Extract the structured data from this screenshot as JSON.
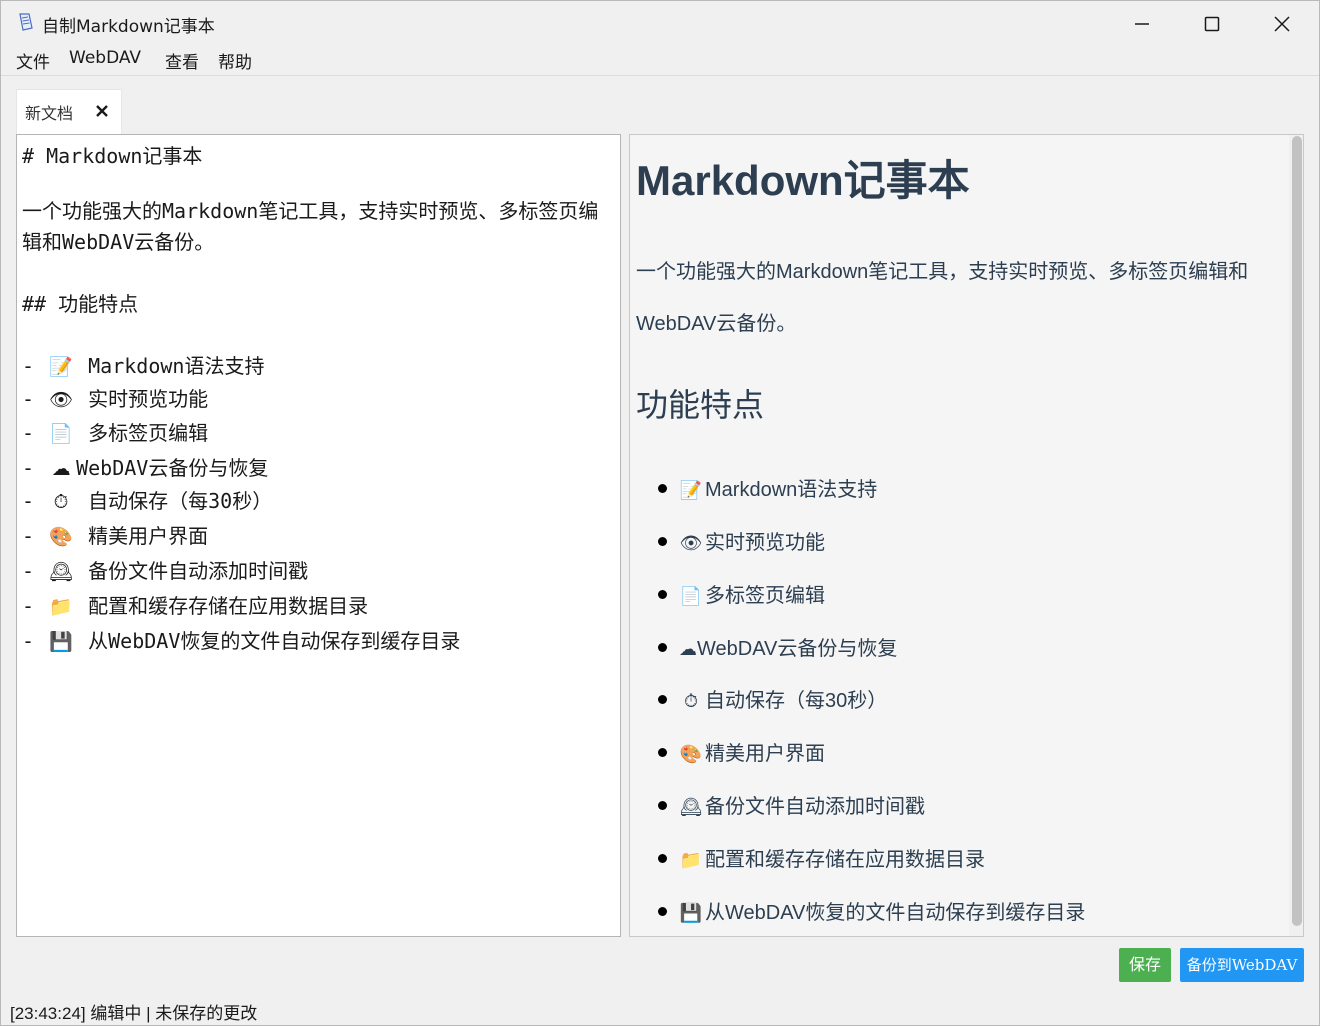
{
  "window": {
    "title": "自制Markdown记事本"
  },
  "menu": [
    "文件",
    "WebDAV",
    "查看",
    "帮助"
  ],
  "tab": {
    "label": "新文档"
  },
  "editor": {
    "h1": "# Markdown记事本",
    "para": "一个功能强大的Markdown笔记工具，支持实时预览、多标签页编辑和WebDAV云备份。",
    "h2": "## 功能特点",
    "items": [
      {
        "emoji": "📝",
        "text": "Markdown语法支持"
      },
      {
        "emoji": "👁",
        "text": "实时预览功能"
      },
      {
        "emoji": "📄",
        "text": "多标签页编辑"
      },
      {
        "emoji": "☁",
        "text": "WebDAV云备份与恢复"
      },
      {
        "emoji": "⏱",
        "text": "自动保存（每30秒）"
      },
      {
        "emoji": "🎨",
        "text": "精美用户界面"
      },
      {
        "emoji": "🕰",
        "text": "备份文件自动添加时间戳"
      },
      {
        "emoji": "📁",
        "text": "配置和缓存存储在应用数据目录"
      },
      {
        "emoji": "💾",
        "text": "从WebDAV恢复的文件自动保存到缓存目录"
      }
    ]
  },
  "preview": {
    "h1": "Markdown记事本",
    "para": "一个功能强大的Markdown笔记工具，支持实时预览、多标签页编辑和WebDAV云备份。",
    "h2": "功能特点",
    "items": [
      {
        "emoji": "📝",
        "text": "Markdown语法支持"
      },
      {
        "emoji": "👁",
        "text": "实时预览功能"
      },
      {
        "emoji": "📄",
        "text": "多标签页编辑"
      },
      {
        "emoji": "☁",
        "text": "WebDAV云备份与恢复"
      },
      {
        "emoji": "⏱",
        "text": "自动保存（每30秒）"
      },
      {
        "emoji": "🎨",
        "text": "精美用户界面"
      },
      {
        "emoji": "🕰",
        "text": "备份文件自动添加时间戳"
      },
      {
        "emoji": "📁",
        "text": "配置和缓存存储在应用数据目录"
      },
      {
        "emoji": "💾",
        "text": "从WebDAV恢复的文件自动保存到缓存目录"
      }
    ]
  },
  "buttons": {
    "save": "保存",
    "backup": "备份到WebDAV"
  },
  "status": "[23:43:24] 编辑中 | 未保存的更改",
  "colors": {
    "save": "#4caf50",
    "backup": "#2196f3",
    "heading": "#2c3e50"
  }
}
